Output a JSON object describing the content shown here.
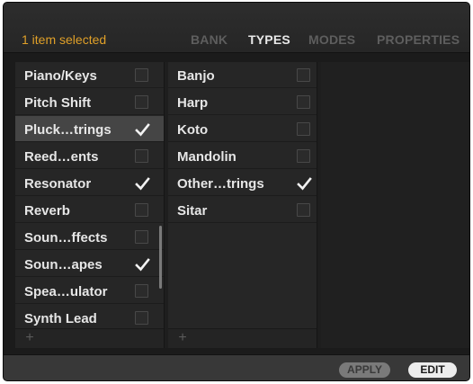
{
  "header": {
    "selection_text": "1 item selected",
    "tabs": [
      {
        "label": "BANK",
        "active": false
      },
      {
        "label": "TYPES",
        "active": true
      },
      {
        "label": "MODES",
        "active": false
      },
      {
        "label": "PROPERTIES",
        "active": false
      }
    ]
  },
  "column1": {
    "items": [
      {
        "label": "Piano/Keys",
        "checked": false,
        "highlighted": false
      },
      {
        "label": "Pitch Shift",
        "checked": false,
        "highlighted": false
      },
      {
        "label": "Pluck…trings",
        "checked": true,
        "highlighted": true
      },
      {
        "label": "Reed…ents",
        "checked": false,
        "highlighted": false
      },
      {
        "label": "Resonator",
        "checked": true,
        "highlighted": false
      },
      {
        "label": "Reverb",
        "checked": false,
        "highlighted": false
      },
      {
        "label": "Soun…ffects",
        "checked": false,
        "highlighted": false
      },
      {
        "label": "Soun…apes",
        "checked": true,
        "highlighted": false
      },
      {
        "label": "Spea…ulator",
        "checked": false,
        "highlighted": false
      },
      {
        "label": "Synth Lead",
        "checked": false,
        "highlighted": false
      }
    ],
    "add_label": "+"
  },
  "column2": {
    "items": [
      {
        "label": "Banjo",
        "checked": false,
        "highlighted": false
      },
      {
        "label": "Harp",
        "checked": false,
        "highlighted": false
      },
      {
        "label": "Koto",
        "checked": false,
        "highlighted": false
      },
      {
        "label": "Mandolin",
        "checked": false,
        "highlighted": false
      },
      {
        "label": "Other…trings",
        "checked": true,
        "highlighted": false
      },
      {
        "label": "Sitar",
        "checked": false,
        "highlighted": false
      }
    ],
    "add_label": "+"
  },
  "footer": {
    "apply_label": "APPLY",
    "edit_label": "EDIT"
  },
  "colors": {
    "accent": "#e0a028",
    "background": "#1b1b1b",
    "highlight_row": "#454545"
  }
}
